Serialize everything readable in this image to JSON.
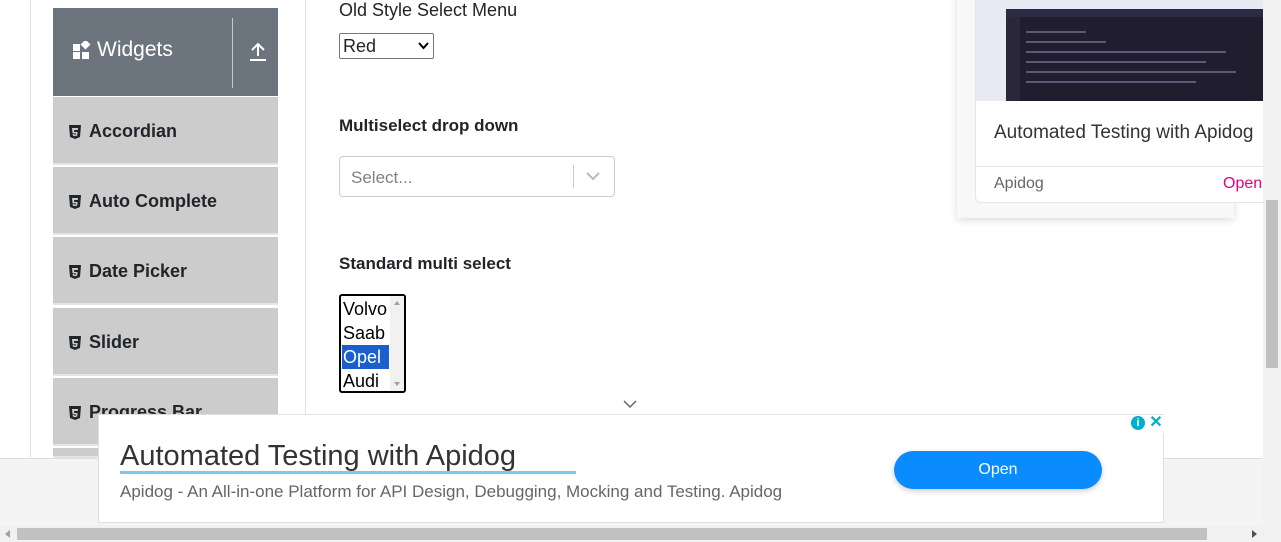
{
  "sidebar": {
    "header": {
      "label": "Widgets"
    },
    "items": [
      {
        "label": "Accordian"
      },
      {
        "label": "Auto Complete"
      },
      {
        "label": "Date Picker"
      },
      {
        "label": "Slider"
      },
      {
        "label": "Progress Bar"
      }
    ]
  },
  "main": {
    "old_select": {
      "label": "Old Style Select Menu",
      "value": "Red"
    },
    "multiselect": {
      "label": "Multiselect drop down",
      "placeholder": "Select..."
    },
    "standard": {
      "label": "Standard multi select",
      "options": [
        "Volvo",
        "Saab",
        "Opel",
        "Audi"
      ],
      "selected": "Opel"
    }
  },
  "side_ad": {
    "title": "Automated Testing with Apidog",
    "brand": "Apidog",
    "cta": "Open"
  },
  "bottom_ad": {
    "title": "Automated Testing with Apidog",
    "description": "Apidog - An All-in-one Platform for API Design, Debugging, Mocking and Testing. Apidog",
    "cta": "Open",
    "info_icon": "i",
    "close_icon": "✕"
  },
  "colors": {
    "sidebar_header": "#6c757d",
    "sidebar_item": "#cccccc",
    "selected_option": "#1a5fcb",
    "ad_button": "#0a8cff",
    "ad_link": "#e6007e"
  }
}
